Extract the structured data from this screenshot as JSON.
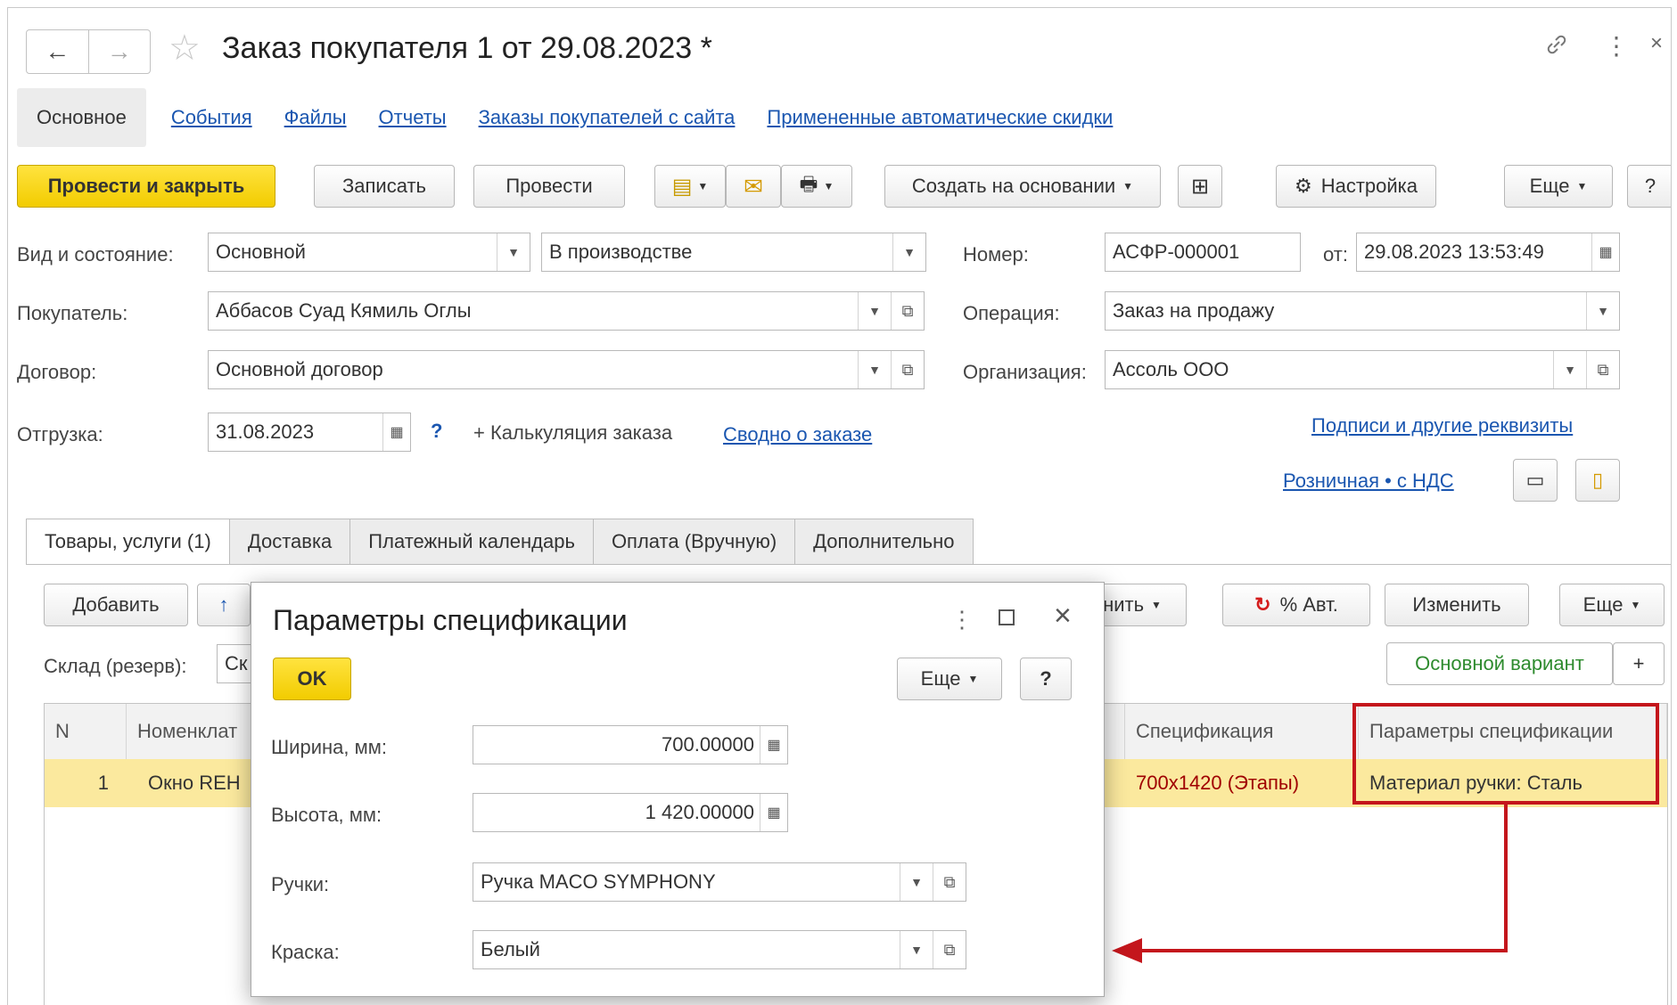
{
  "window": {
    "title": "Заказ покупателя 1 от 29.08.2023 *"
  },
  "topnav": {
    "items": [
      "Основное",
      "События",
      "Файлы",
      "Отчеты",
      "Заказы покупателей с сайта",
      "Примененные автоматические скидки"
    ]
  },
  "toolbar": {
    "post_close": "Провести и закрыть",
    "save": "Записать",
    "post": "Провести",
    "create_based": "Создать на основании",
    "settings": "Настройка",
    "more": "Еще",
    "help": "?"
  },
  "form": {
    "kind_label": "Вид и состояние:",
    "kind_value": "Основной",
    "state_value": "В производстве",
    "number_label": "Номер:",
    "number_value": "АСФР-000001",
    "date_label": "от:",
    "date_value": "29.08.2023 13:53:49",
    "customer_label": "Покупатель:",
    "customer_value": "Аббасов Суад Кямиль Оглы",
    "operation_label": "Операция:",
    "operation_value": "Заказ на продажу",
    "contract_label": "Договор:",
    "contract_value": "Основной договор",
    "org_label": "Организация:",
    "org_value": "Ассоль ООО",
    "shipment_label": "Отгрузка:",
    "shipment_value": "31.08.2023",
    "question": "?",
    "calc_link": "+ Калькуляция заказа",
    "summary_link": "Сводно о заказе",
    "signatures_link": "Подписи и другие реквизиты",
    "price_link": "Розничная • с НДС"
  },
  "tabs": [
    "Товары, услуги (1)",
    "Доставка",
    "Платежный календарь",
    "Оплата (Вручную)",
    "Дополнительно"
  ],
  "items_toolbar": {
    "add": "Добавить",
    "fill_partial": "нить",
    "auto_percent": "% Авт.",
    "change": "Изменить",
    "more": "Еще",
    "warehouse_label": "Склад (резерв):",
    "warehouse_partial": "Ск",
    "main_variant": "Основной вариант",
    "plus": "+"
  },
  "grid": {
    "columns": {
      "n": "N",
      "item": "Номенклат",
      "spec": "Спецификация",
      "spec_params": "Параметры спецификации"
    },
    "rows": [
      {
        "n": "1",
        "item": "Окно REH",
        "spec": "700x1420 (Этапы)",
        "spec_params": "Материал ручки: Сталь"
      }
    ]
  },
  "dialog": {
    "title": "Параметры спецификации",
    "ok": "OK",
    "more": "Еще",
    "help": "?",
    "width_label": "Ширина, мм:",
    "width_value": "700.00000",
    "height_label": "Высота, мм:",
    "height_value": "1 420.00000",
    "handles_label": "Ручки:",
    "handles_value": "Ручка MACO SYMPHONY",
    "paint_label": "Краска:",
    "paint_value": "Белый"
  },
  "colors": {
    "accent_yellow": "#f5d000",
    "link": "#1a56b0",
    "highlight": "#c4161c",
    "row_select": "#fbe99e",
    "spec_text": "#a00000"
  }
}
